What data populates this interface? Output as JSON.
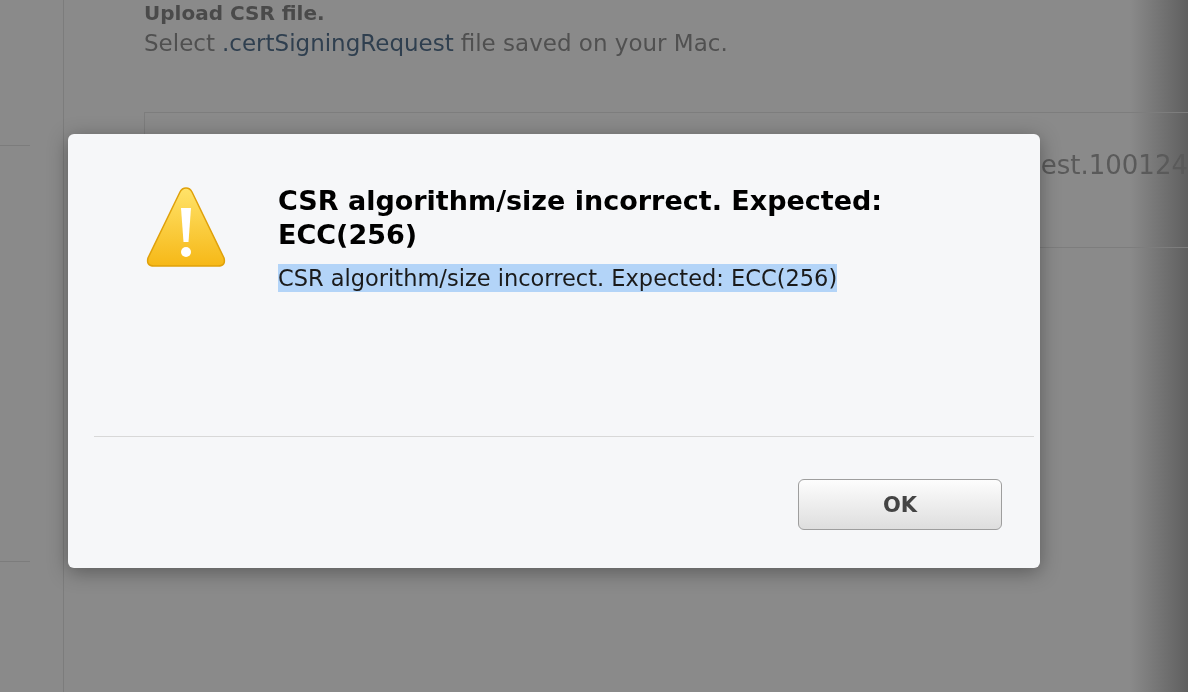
{
  "page": {
    "heading": "Upload CSR file.",
    "instruction": {
      "before": "Select",
      "link": ".certSigningRequest",
      "after": "file saved on your Mac."
    },
    "file_name": "est.100124"
  },
  "dialog": {
    "title": "CSR algorithm/size incorrect. Expected: ECC(256)",
    "message": {
      "text": "CSR algorithm/size incorrect. Expected: ECC(256)",
      "selected": true
    },
    "buttons": [
      "OK"
    ]
  }
}
